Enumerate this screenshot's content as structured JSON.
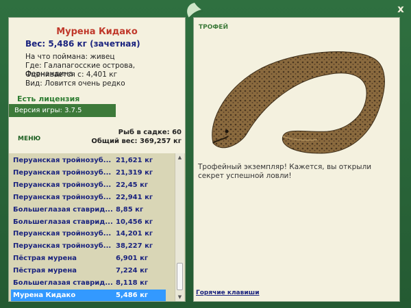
{
  "window": {
    "close_label": "x"
  },
  "fish": {
    "name": "Мурена Кидако",
    "weight": "Вес: 5,486 кг (зачетная)",
    "bait": "На что поймана: живец",
    "location": "Где: Галапагосские острова, Фернандина",
    "estimated": "Оценивается с: 4,401 кг",
    "rarity": "Вид: Ловится очень редко"
  },
  "license": "Есть лицензия",
  "version": "Версия игры: 3.7.5",
  "menu_label": "МЕНЮ",
  "stats": {
    "count": "Рыб в садке: 60",
    "total": "Общий вес: 369,257 кг"
  },
  "catches": [
    {
      "name": "Перуанская тройнозуб...",
      "weight": "21,621 кг"
    },
    {
      "name": "Перуанская тройнозуб...",
      "weight": "21,319 кг"
    },
    {
      "name": "Перуанская тройнозуб...",
      "weight": "22,45 кг"
    },
    {
      "name": "Перуанская тройнозуб...",
      "weight": "22,941 кг"
    },
    {
      "name": "Большеглазая ставрид...",
      "weight": "8,85 кг"
    },
    {
      "name": "Большеглазая ставрид...",
      "weight": "10,456 кг"
    },
    {
      "name": "Перуанская тройнозуб...",
      "weight": "14,201 кг"
    },
    {
      "name": "Перуанская тройнозуб...",
      "weight": "38,227 кг"
    },
    {
      "name": "Пёстрая мурена",
      "weight": "6,901 кг"
    },
    {
      "name": "Пёстрая мурена",
      "weight": "7,224 кг"
    },
    {
      "name": "Большеглазая ставрид...",
      "weight": "8,118 кг"
    },
    {
      "name": "Мурена Кидако",
      "weight": "5,486 кг",
      "selected": true
    }
  ],
  "trophy_label": "ТРОФЕЙ",
  "trophy_text": "Трофейный экземпляр! Кажется, вы открыли секрет успешной ловли!",
  "hotkeys_label": "Горячие клавиши",
  "colors": {
    "frame": "#2e6a3b",
    "panel": "#f4f1df",
    "title": "#c0392b",
    "selected": "#3399ff"
  }
}
